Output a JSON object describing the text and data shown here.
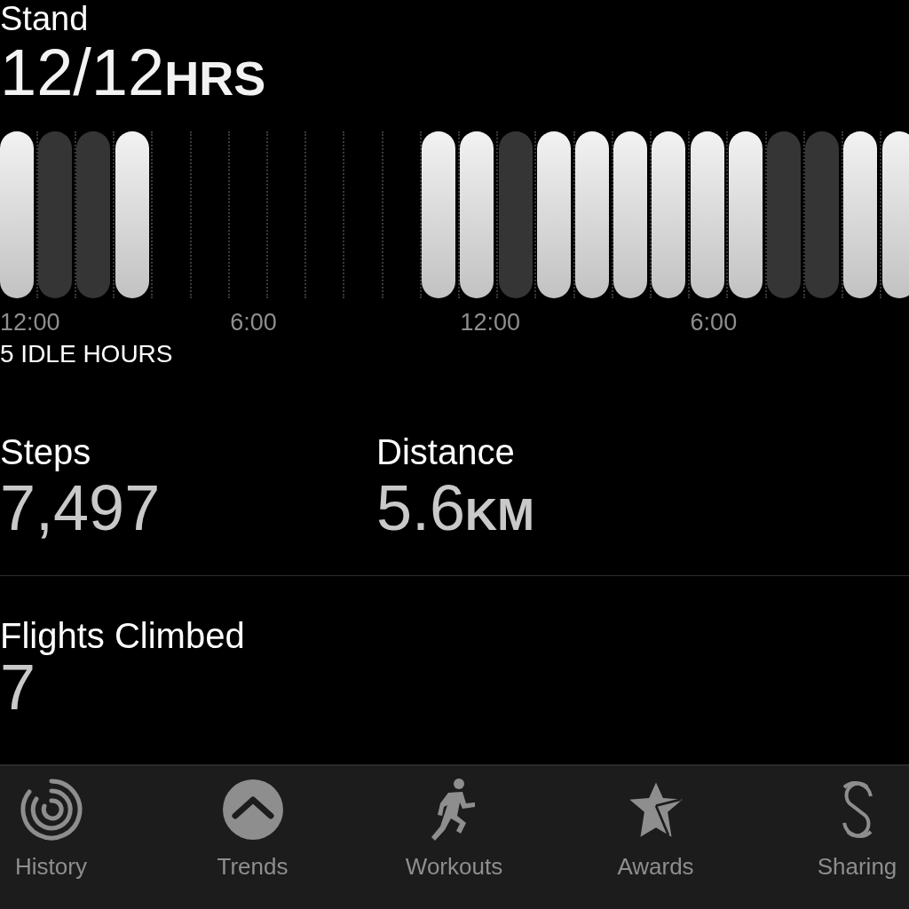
{
  "stand": {
    "title": "Stand",
    "value": "12/12",
    "unit": "HRS",
    "hours": [
      {
        "kind": "stood"
      },
      {
        "kind": "idle"
      },
      {
        "kind": "idle"
      },
      {
        "kind": "stood"
      },
      {
        "kind": "empty"
      },
      {
        "kind": "empty"
      },
      {
        "kind": "empty"
      },
      {
        "kind": "empty"
      },
      {
        "kind": "empty"
      },
      {
        "kind": "empty"
      },
      {
        "kind": "empty"
      },
      {
        "kind": "stood"
      },
      {
        "kind": "stood"
      },
      {
        "kind": "idle"
      },
      {
        "kind": "stood"
      },
      {
        "kind": "stood"
      },
      {
        "kind": "stood"
      },
      {
        "kind": "stood"
      },
      {
        "kind": "stood"
      },
      {
        "kind": "stood"
      },
      {
        "kind": "idle"
      },
      {
        "kind": "idle"
      },
      {
        "kind": "stood"
      },
      {
        "kind": "stood"
      }
    ],
    "time_labels": [
      "12:00",
      "6:00",
      "12:00",
      "6:00"
    ],
    "idle_note": "5 IDLE HOURS"
  },
  "metrics": [
    {
      "label": "Steps",
      "value": "7,497"
    },
    {
      "label": "Distance",
      "value": "5.6",
      "unit": "KM"
    }
  ],
  "flights": {
    "label": "Flights Climbed",
    "value": "7"
  },
  "tabs": [
    "History",
    "Trends",
    "Workouts",
    "Awards",
    "Sharing"
  ]
}
